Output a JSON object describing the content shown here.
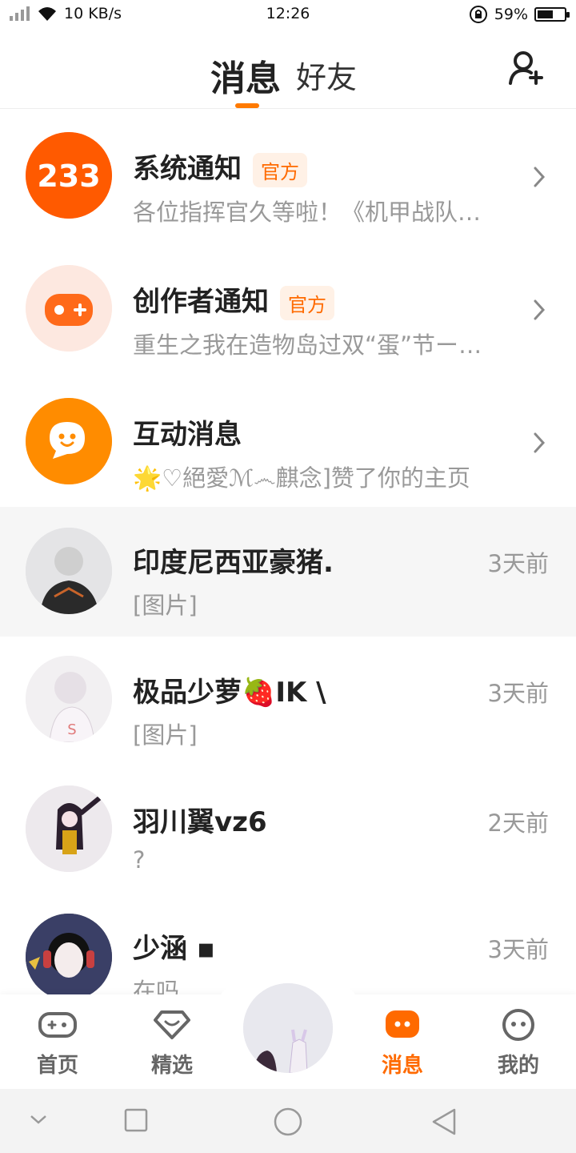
{
  "status_bar": {
    "network_speed": "10 KB/s",
    "time": "12:26",
    "battery_percent": "59%",
    "battery_level": 0.59
  },
  "header": {
    "tab_messages": "消息",
    "tab_friends": "好友",
    "add_friend_icon": "add-user-icon"
  },
  "system_items": [
    {
      "title": "系统通知",
      "badge": "官方",
      "preview": "各位指挥官久等啦！《机甲战队…",
      "icon": "logo-233-icon",
      "color": "#ff5a00"
    },
    {
      "title": "创作者通知",
      "badge": "官方",
      "preview": "重生之我在造物岛过双“蛋”节ー一…",
      "icon": "gamepad-plus-icon",
      "color": "#ff6a1a"
    },
    {
      "title": "互动消息",
      "badge": "",
      "preview": "🌟♡絕愛ℳ෴麒念]赞了你的主页",
      "icon": "chat-smile-icon",
      "color": "#ff8c00"
    }
  ],
  "conversations": [
    {
      "name": "印度尼西亚豪猪.",
      "preview": "[图片]",
      "time": "3天前"
    },
    {
      "name": "极品少萝🍓IK \\",
      "preview": "[图片]",
      "time": "3天前"
    },
    {
      "name": "羽川翼vz6",
      "preview": "?",
      "time": "2天前"
    },
    {
      "name": "少涵 ▪",
      "preview": "在吗",
      "time": "3天前"
    }
  ],
  "bottom_nav": {
    "home": "首页",
    "featured": "精选",
    "messages": "消息",
    "mine": "我的",
    "accent": "#ff6a00"
  }
}
